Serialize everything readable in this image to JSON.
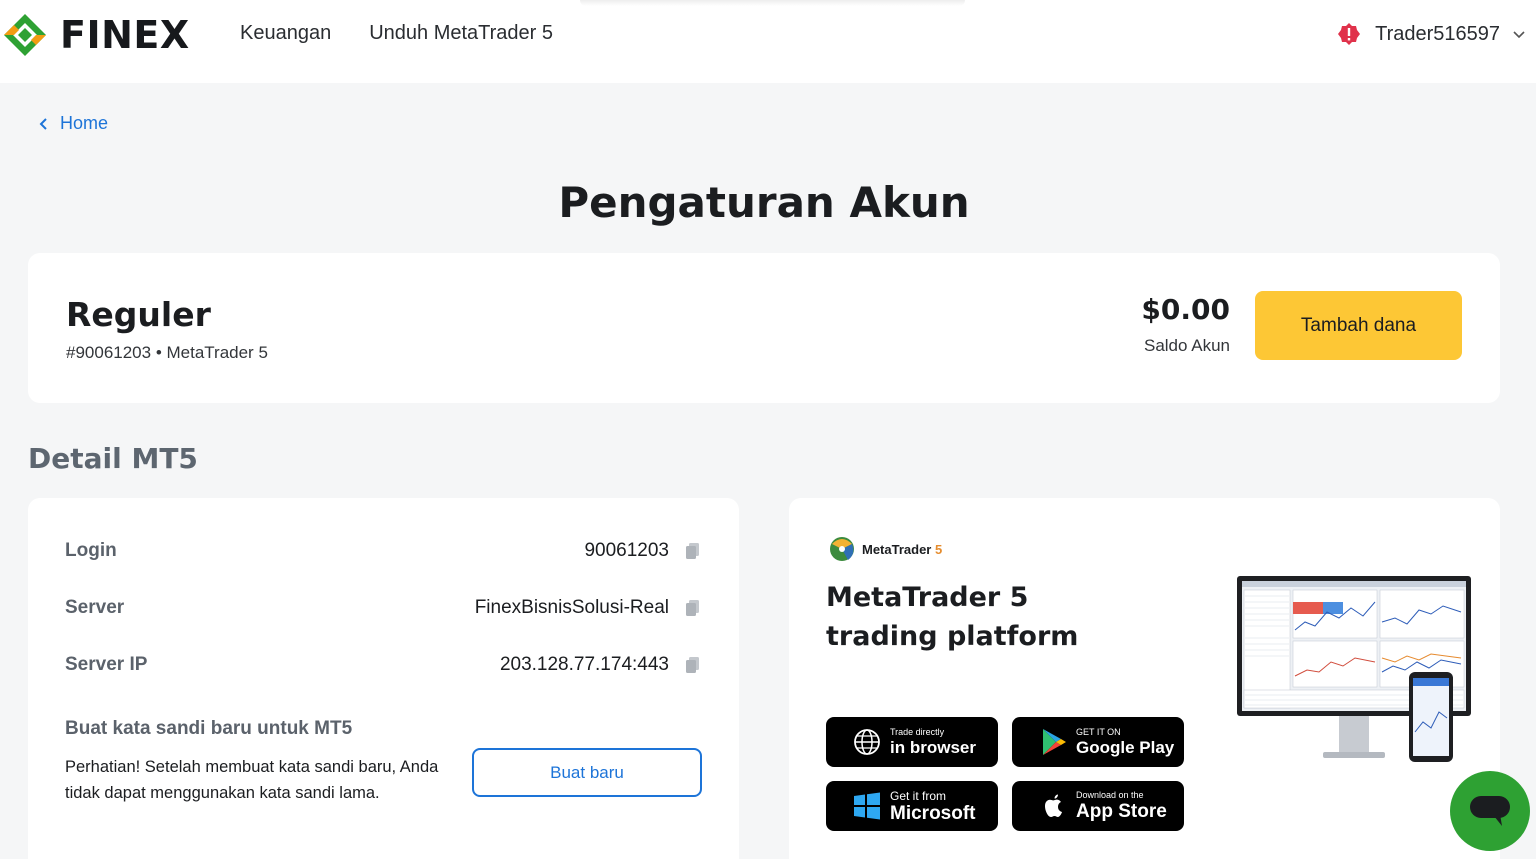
{
  "header": {
    "brand": "FINEX",
    "nav": [
      "Keuangan",
      "Unduh MetaTrader 5"
    ],
    "user": "Trader516597",
    "icons": {
      "logo": "finex-logo-icon",
      "warning": "warning-icon",
      "chevron": "chevron-down-icon"
    },
    "colors": {
      "logo_green": "#2ea133",
      "logo_orange": "#f39c12",
      "warning": "#e0324b"
    }
  },
  "breadcrumb": {
    "label": "Home"
  },
  "page": {
    "title": "Pengaturan Akun"
  },
  "account": {
    "type": "Reguler",
    "subtitle": "#90061203 • MetaTrader 5",
    "balance": "$0.00",
    "balance_label": "Saldo Akun",
    "fund_button": "Tambah dana",
    "fund_color": "#fdc735"
  },
  "details": {
    "section_title": "Detail MT5",
    "rows": [
      {
        "label": "Login",
        "value": "90061203"
      },
      {
        "label": "Server",
        "value": "FinexBisnisSolusi-Real"
      },
      {
        "label": "Server IP",
        "value": "203.128.77.174:443"
      }
    ],
    "password_title": "Buat kata sandi baru untuk MT5",
    "password_note": "Perhatian! Setelah membuat kata sandi baru, Anda tidak dapat menggunakan kata sandi lama.",
    "new_button": "Buat baru",
    "accent": "#1d74d8"
  },
  "metatrader": {
    "brand_name": "MetaTrader",
    "brand_num": "5",
    "heading_line1": "MetaTrader 5",
    "heading_line2": "trading platform",
    "stores": [
      {
        "small": "Trade directly",
        "big": "in browser",
        "icon": "globe-icon"
      },
      {
        "small": "GET IT ON",
        "big": "Google Play",
        "icon": "google-play-icon"
      },
      {
        "small": "Get it from",
        "big": "Microsoft",
        "icon": "windows-icon"
      },
      {
        "small": "Download on the",
        "big": "App Store",
        "icon": "apple-icon"
      }
    ]
  },
  "chat": {
    "icon": "chat-icon",
    "color": "#2ea133"
  }
}
